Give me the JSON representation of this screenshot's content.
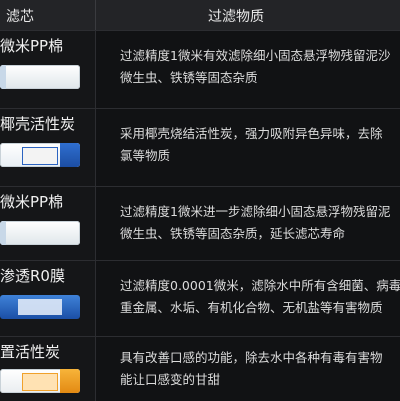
{
  "header": {
    "col1": "滤芯",
    "col2": "过滤物质"
  },
  "rows": [
    {
      "name": "微米PP棉",
      "icon": "pp-cotton-filter-icon",
      "line1": "过滤精度1微米有效滤除细小固态悬浮物残留泥沙",
      "line2": "微生虫、铁锈等固态杂质"
    },
    {
      "name": "椰壳活性炭",
      "icon": "coconut-carbon-filter-icon",
      "line1": "采用椰壳烧结活性炭，强力吸附异色异味，去除",
      "line2": "氯等物质"
    },
    {
      "name": "微米PP棉",
      "icon": "pp-cotton-filter-icon",
      "line1": "过滤精度1微米进一步滤除细小固态悬浮物残留泥",
      "line2": "微生虫、铁锈等固态杂质，延长滤芯寿命"
    },
    {
      "name": "渗透R0膜",
      "icon": "ro-membrane-filter-icon",
      "line1": "过滤精度0.0001微米，滤除水中所有含细菌、病毒",
      "line2": "重金属、水垢、有机化合物、无机盐等有害物质"
    },
    {
      "name": "置活性炭",
      "icon": "post-carbon-filter-icon",
      "line1": "具有改善口感的功能，除去水中各种有毒有害物",
      "line2": "能让口感变的甘甜"
    }
  ],
  "colors": {
    "background": "#111214",
    "header_background": "#232427",
    "coconut_band": "#2f6fd0",
    "ro_membrane": "#1b4fa6",
    "post_carbon_band": "#f0a12b"
  }
}
